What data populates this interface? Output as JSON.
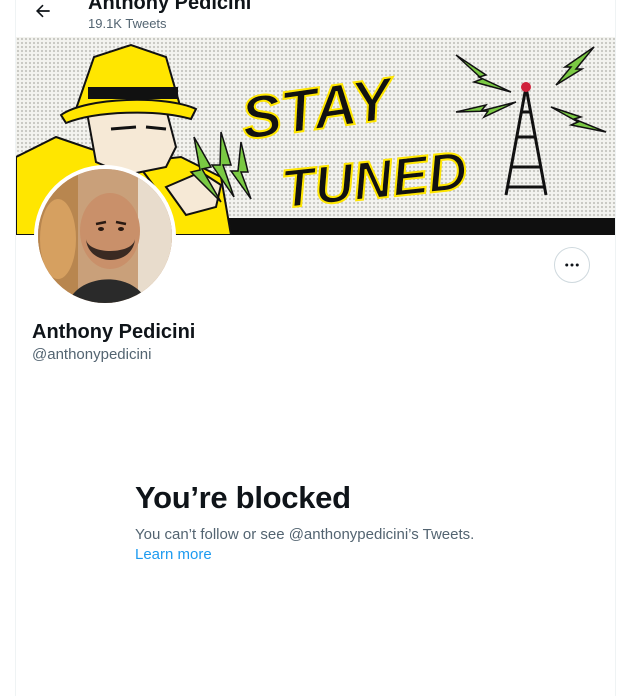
{
  "header": {
    "back_icon": "arrow-left-icon",
    "name": "Anthony Pedicini",
    "tweet_count": "19.1K Tweets"
  },
  "banner": {
    "line1": "STAY",
    "line2": "TUNED",
    "colors": {
      "yellow": "#ffe600",
      "black": "#0f0f0f",
      "green": "#7ac943"
    }
  },
  "profile": {
    "display_name": "Anthony Pedicini",
    "handle": "@anthonypedicini",
    "more_icon": "more-horizontal-icon"
  },
  "blocked": {
    "title": "You’re blocked",
    "message": "You can’t follow or see @anthonypedicini’s Tweets.",
    "learn_more": "Learn more"
  },
  "colors": {
    "text_primary": "#0f1419",
    "text_secondary": "#536471",
    "link": "#1d9bf0",
    "border": "#eff3f4"
  }
}
